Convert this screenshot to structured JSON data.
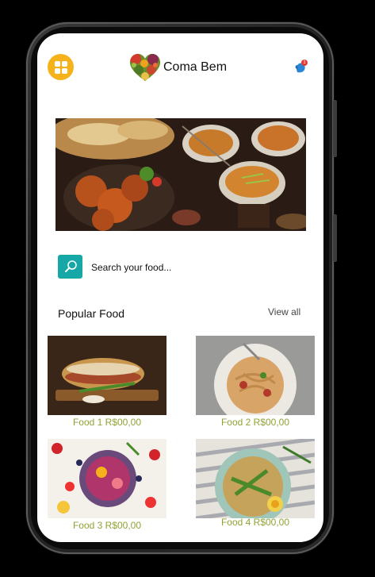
{
  "app": {
    "name": "Coma Bem"
  },
  "header": {
    "notification_count": "1"
  },
  "search": {
    "placeholder": "Search your food..."
  },
  "popular": {
    "title": "Popular Food",
    "view_all": "View all",
    "items": [
      {
        "label": "Food 1 R$00,00"
      },
      {
        "label": "Food 2 R$00,00"
      },
      {
        "label": "Food 3 R$00,00"
      },
      {
        "label": "Food 4 R$00,00"
      }
    ]
  },
  "colors": {
    "menu_button": "#f5b21a",
    "search_button": "#15a8a6",
    "price_text": "#8fa335",
    "notification_badge": "#e53935"
  },
  "icons": {
    "menu": "grid-icon",
    "logo": "heart-vegetables-logo",
    "notification": "notification-bell-icon",
    "search": "magnifier-icon"
  }
}
